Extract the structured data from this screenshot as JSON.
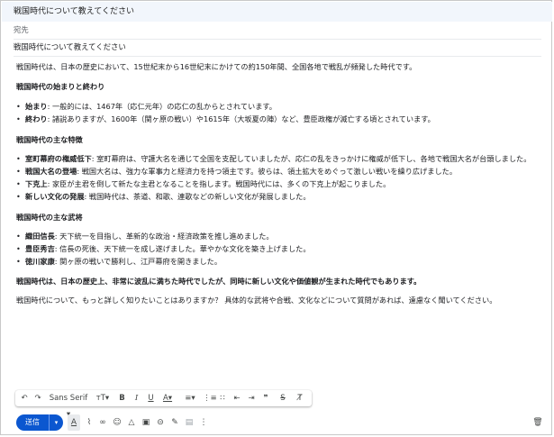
{
  "window": {
    "title": "戦国時代について教えてください"
  },
  "fields": {
    "to_label": "宛先",
    "subject": "戦国時代について教えてください"
  },
  "body": {
    "intro": "戦国時代は、日本の歴史において、15世紀末から16世紀末にかけての約150年間、全国各地で戦乱が頻発した時代です。",
    "sections": [
      {
        "heading": "戦国時代の始まりと終わり",
        "items": [
          {
            "term": "始まり",
            "text": ": 一般的には、1467年（応仁元年）の応仁の乱からとされています。"
          },
          {
            "term": "終わり",
            "text": ": 諸説ありますが、1600年（関ヶ原の戦い）や1615年（大坂夏の陣）など、豊臣政権が滅亡する頃とされています。"
          }
        ]
      },
      {
        "heading": "戦国時代の主な特徴",
        "items": [
          {
            "term": "室町幕府の権威低下",
            "text": ": 室町幕府は、守護大名を通じて全国を支配していましたが、応仁の乱をきっかけに権威が低下し、各地で戦国大名が台頭しました。"
          },
          {
            "term": "戦国大名の登場",
            "text": ": 戦国大名は、強力な軍事力と経済力を持つ領主です。彼らは、領土拡大をめぐって激しい戦いを繰り広げました。"
          },
          {
            "term": "下克上",
            "text": ": 家臣が主君を倒して新たな主君となることを指します。戦国時代には、多くの下克上が起こりました。"
          },
          {
            "term": "新しい文化の発展",
            "text": ": 戦国時代は、茶道、和歌、連歌などの新しい文化が発展しました。"
          }
        ]
      },
      {
        "heading": "戦国時代の主な武将",
        "items": [
          {
            "term": "織田信長",
            "text": ": 天下統一を目指し、革新的な政治・経済政策を推し進めました。"
          },
          {
            "term": "豊臣秀吉",
            "text": ": 信長の死後、天下統一を成し遂げました。華やかな文化を築き上げました。"
          },
          {
            "term": "徳川家康",
            "text": ": 関ヶ原の戦いで勝利し、江戸幕府を開きました。"
          }
        ]
      }
    ],
    "conclusion": "戦国時代は、日本の歴史上、非常に波乱に満ちた時代でしたが、同時に新しい文化や価値観が生まれた時代でもあります。",
    "closing": "戦国時代について、もっと詳しく知りたいことはありますか？ 具体的な武将や合戦、文化などについて質問があれば、遠慮なく聞いてください。"
  },
  "format_toolbar": {
    "font": "Sans Serif",
    "icons": [
      "undo-icon",
      "redo-icon",
      "font-dropdown",
      "font-size-icon",
      "bold-icon",
      "italic-icon",
      "underline-icon",
      "text-color-icon",
      "align-icon",
      "numbered-list-icon",
      "bulleted-list-icon",
      "indent-less-icon",
      "indent-more-icon",
      "quote-icon",
      "strikethrough-icon",
      "clear-format-icon"
    ]
  },
  "bottom": {
    "send_label": "送信"
  }
}
